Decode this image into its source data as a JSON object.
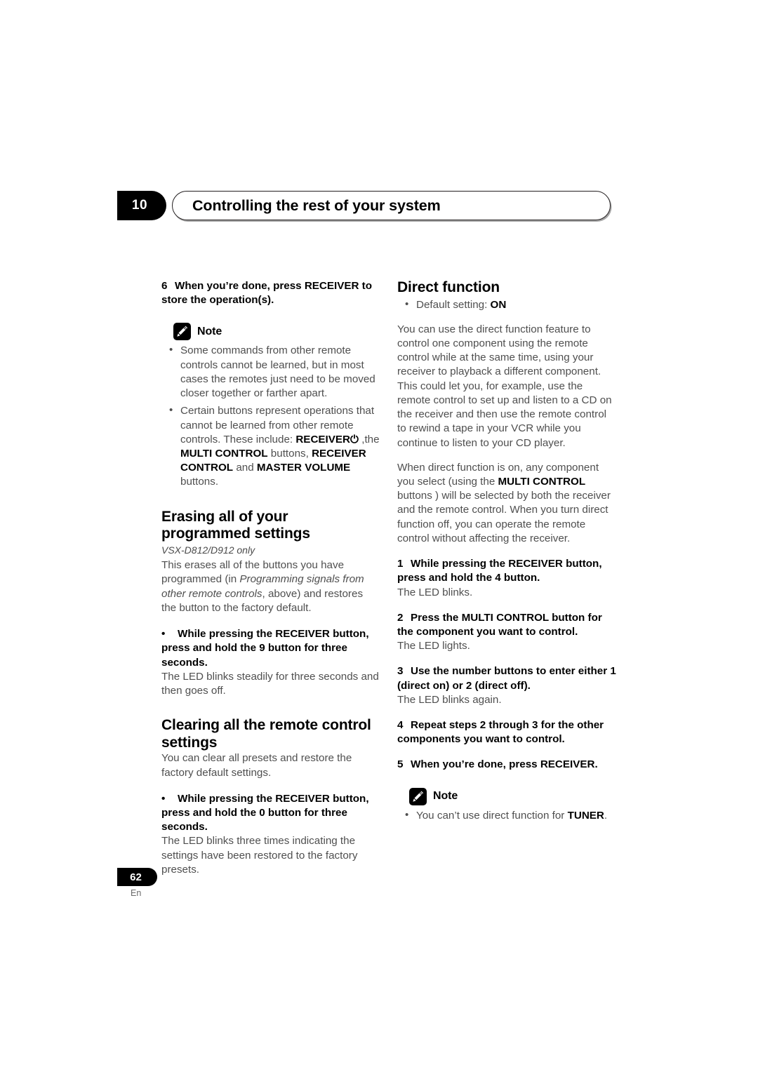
{
  "header": {
    "chapter_number": "10",
    "title": "Controlling the rest of your system"
  },
  "footer": {
    "page_number": "62",
    "language": "En"
  },
  "note_label": "Note",
  "left_column": {
    "step6": {
      "number": "6",
      "text": "When you’re done, press RECEIVER to store the operation(s)."
    },
    "note_bullets": [
      "Some commands from other remote controls cannot be learned, but in most cases the remotes just need to be moved closer together or farther apart."
    ],
    "note_bullet2": {
      "part1": "Certain buttons represent operations that cannot be learned from other remote controls. These include: ",
      "bold1": "RECEIVER",
      "symbol": "⏻",
      "mid1": " ,the ",
      "bold2": "MULTI CONTROL",
      "mid2": " buttons, ",
      "bold3": "RECEIVER CONTROL",
      "mid3": " and ",
      "bold4": "MASTER VOLUME",
      "tail": " buttons."
    },
    "erasing": {
      "heading": "Erasing all of your programmed settings",
      "model_note": "VSX-D812/D912 only",
      "para_part1": "This erases all of the buttons you have programmed (in ",
      "para_italic": "Programming signals from other remote controls",
      "para_part2": ", above) and restores the button to the factory default.",
      "bullet_step": "While pressing the RECEIVER button, press and hold the 9 button for three seconds.",
      "result": "The LED blinks steadily for three seconds and then goes off."
    },
    "clearing": {
      "heading": "Clearing all the remote control settings",
      "para": "You can clear all presets and restore the factory default settings.",
      "bullet_step": "While pressing the RECEIVER button, press and hold the 0 button for three seconds.",
      "result": "The LED blinks three times indicating the settings have been restored to the factory presets."
    }
  },
  "right_column": {
    "heading": "Direct function",
    "default_setting": {
      "label": "Default setting: ",
      "value": "ON"
    },
    "para1": "You can use the direct function feature to control one component using the remote control while at the same time, using your receiver to playback a different component. This could let you, for example, use the remote control to set up and listen to a CD on the receiver and then use the remote control to rewind a tape in your VCR while you continue to listen to your CD player.",
    "para2": {
      "part1": "When direct function is on, any component you select (using the ",
      "bold1": "MULTI CONTROL",
      "part2": " buttons ) will be selected by both the receiver and the remote control. When you turn direct function off, you can operate the remote control without affecting the receiver."
    },
    "steps": [
      {
        "number": "1",
        "text": "While pressing the RECEIVER button, press and hold the 4 button.",
        "result": "The LED blinks."
      },
      {
        "number": "2",
        "text": "Press the MULTI CONTROL button for the component you want to control.",
        "result": "The LED lights."
      },
      {
        "number": "3",
        "text": "Use the number buttons to enter either 1 (direct on) or 2 (direct off).",
        "result": "The LED blinks again."
      },
      {
        "number": "4",
        "text": "Repeat steps 2 through 3 for the other components you want to control.",
        "result": ""
      },
      {
        "number": "5",
        "text": "When you’re done, press RECEIVER.",
        "result": ""
      }
    ],
    "note_bullet": {
      "part1": "You can’t use direct function for ",
      "bold": "TUNER",
      "part2": "."
    }
  }
}
